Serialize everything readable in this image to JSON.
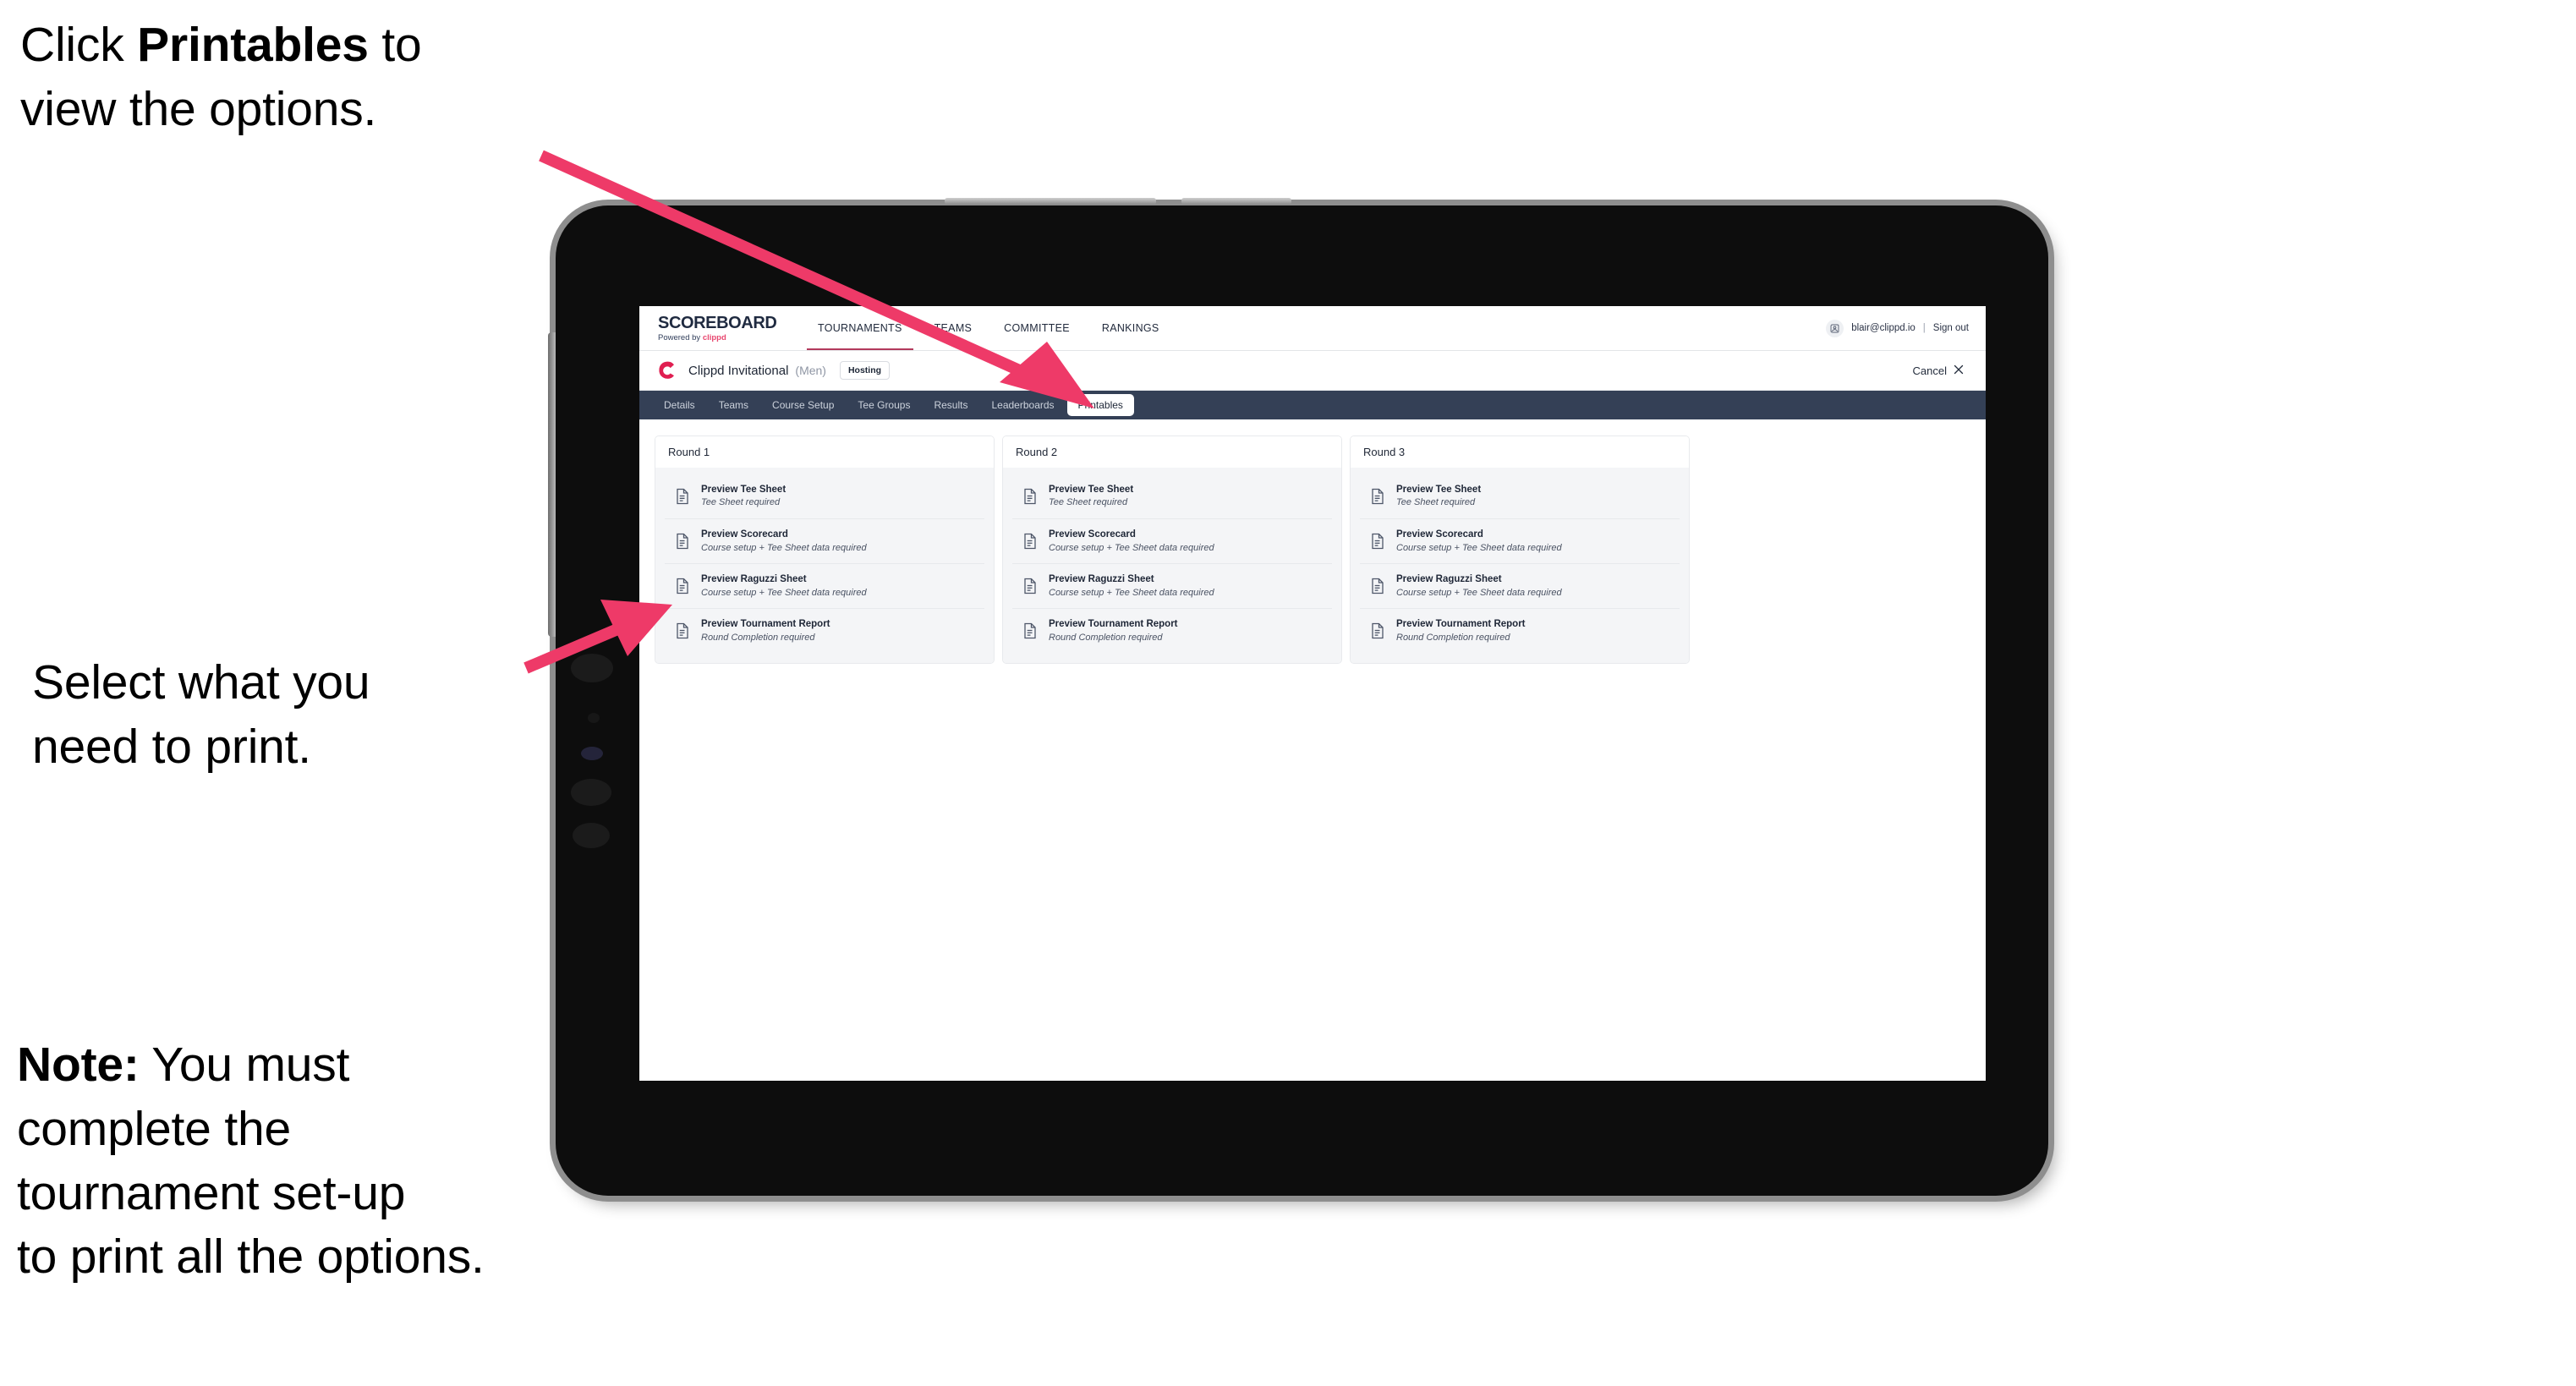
{
  "annotations": {
    "click_printables": {
      "prefix": "Click ",
      "bold": "Printables",
      "suffix": " to\nview the options."
    },
    "select_print": "Select what you\n need to print.",
    "note": {
      "bold": "Note:",
      "rest": " You must\ncomplete the\ntournament set-up\nto print all the options."
    }
  },
  "arrows": {
    "color": "#ee3a68",
    "arrow_1_name": "arrow-to-printables-tab",
    "arrow_2_name": "arrow-to-printable-options"
  },
  "app": {
    "brand": {
      "title": "SCOREBOARD",
      "powered_by": "Powered by ",
      "powered_by_brand": "clippd"
    },
    "topnav": [
      {
        "label": "TOURNAMENTS",
        "active": true
      },
      {
        "label": "TEAMS",
        "active": false
      },
      {
        "label": "COMMITTEE",
        "active": false
      },
      {
        "label": "RANKINGS",
        "active": false
      }
    ],
    "account": {
      "avatar_icon": "user-avatar-icon",
      "email": "blair@clippd.io",
      "separator": "|",
      "sign_out": "Sign out"
    },
    "tournament": {
      "logo_icon": "clippd-c-logo-icon",
      "name": "Clippd Invitational",
      "gender": "(Men)",
      "status_badge": "Hosting",
      "cancel_label": "Cancel",
      "cancel_icon": "close-x-icon"
    },
    "tabs": [
      {
        "label": "Details",
        "active": false
      },
      {
        "label": "Teams",
        "active": false
      },
      {
        "label": "Course Setup",
        "active": false
      },
      {
        "label": "Tee Groups",
        "active": false
      },
      {
        "label": "Results",
        "active": false
      },
      {
        "label": "Leaderboards",
        "active": false
      },
      {
        "label": "Printables",
        "active": true
      }
    ],
    "rounds": [
      {
        "title": "Round 1",
        "items": [
          {
            "icon": "document-icon",
            "title": "Preview Tee Sheet",
            "sub": "Tee Sheet required"
          },
          {
            "icon": "document-icon",
            "title": "Preview Scorecard",
            "sub": "Course setup + Tee Sheet data required"
          },
          {
            "icon": "document-icon",
            "title": "Preview Raguzzi Sheet",
            "sub": "Course setup + Tee Sheet data required"
          },
          {
            "icon": "document-icon",
            "title": "Preview Tournament Report",
            "sub": "Round Completion required"
          }
        ]
      },
      {
        "title": "Round 2",
        "items": [
          {
            "icon": "document-icon",
            "title": "Preview Tee Sheet",
            "sub": "Tee Sheet required"
          },
          {
            "icon": "document-icon",
            "title": "Preview Scorecard",
            "sub": "Course setup + Tee Sheet data required"
          },
          {
            "icon": "document-icon",
            "title": "Preview Raguzzi Sheet",
            "sub": "Course setup + Tee Sheet data required"
          },
          {
            "icon": "document-icon",
            "title": "Preview Tournament Report",
            "sub": "Round Completion required"
          }
        ]
      },
      {
        "title": "Round 3",
        "items": [
          {
            "icon": "document-icon",
            "title": "Preview Tee Sheet",
            "sub": "Tee Sheet required"
          },
          {
            "icon": "document-icon",
            "title": "Preview Scorecard",
            "sub": "Course setup + Tee Sheet data required"
          },
          {
            "icon": "document-icon",
            "title": "Preview Raguzzi Sheet",
            "sub": "Course setup + Tee Sheet data required"
          },
          {
            "icon": "document-icon",
            "title": "Preview Tournament Report",
            "sub": "Round Completion required"
          }
        ]
      }
    ]
  },
  "colors": {
    "accent_pink": "#ee3a68",
    "brand_red": "#e8476f",
    "tabstrip_navy": "#344056",
    "board_bg": "#f4f5f7"
  }
}
